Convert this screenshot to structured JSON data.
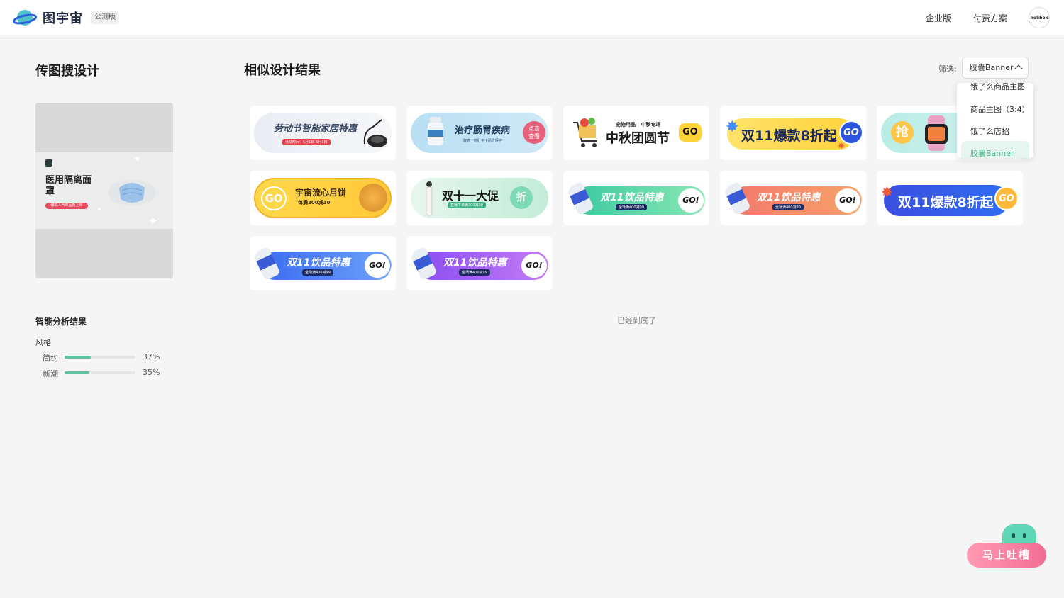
{
  "header": {
    "brand": "图宇宙",
    "beta_badge": "公测版",
    "nav": {
      "enterprise": "企业版",
      "pricing": "付费方案"
    },
    "avatar_text": "nolibox"
  },
  "left_panel": {
    "title": "传图搜设计",
    "upload_preview": {
      "title": "医用隔离面罩",
      "tag": "爆款人气单品新上市"
    },
    "analysis_title": "智能分析结果",
    "style_label": "风格",
    "styles": [
      {
        "name": "简约",
        "percent": 37,
        "label": "37%"
      },
      {
        "name": "新潮",
        "percent": 35,
        "label": "35%"
      }
    ]
  },
  "results": {
    "title": "相似设计结果",
    "filter_label": "筛选:",
    "filter_value": "胶囊Banner",
    "dropdown": [
      "饿了么商品主图",
      "商品主图（3:4）",
      "饿了么店招",
      "胶囊Banner"
    ],
    "cards": [
      {
        "text": "劳动节智能家居特惠",
        "sub": "活动时间：5月1日-5月3日",
        "theme": "labor"
      },
      {
        "text": "治疗肠胃疾病",
        "sub": "腹痛 | 拉肚子 | 肠胃保护",
        "badge": "点击查看",
        "theme": "stomach"
      },
      {
        "text": "中秋团圆节",
        "sub": "宠物用品 | 中秋专场",
        "badge": "GO",
        "theme": "midautumn"
      },
      {
        "text": "双11爆款8折起",
        "badge": "GO",
        "theme": "yellow11"
      },
      {
        "text": "抢",
        "theme": "watch"
      },
      {
        "text": "宇宙流心月饼",
        "sub": "每满200减30",
        "badge": "GO",
        "theme": "mooncake"
      },
      {
        "text": "双十一大促",
        "sub": "直播下单满300减30",
        "badge": "折",
        "theme": "promo11"
      },
      {
        "text": "双11饮品特惠",
        "sub": "全场满400减99",
        "badge": "GO!",
        "theme": "drink-green"
      },
      {
        "text": "双11饮品特惠",
        "sub": "全场满400减99",
        "badge": "GO!",
        "theme": "drink-orange"
      },
      {
        "text": "双11爆款8折起",
        "badge": "GO",
        "theme": "blue11"
      },
      {
        "text": "双11饮品特惠",
        "sub": "全场满400减99",
        "badge": "GO!",
        "theme": "drink-blue"
      },
      {
        "text": "双11饮品特惠",
        "sub": "全场满400减99",
        "badge": "GO!",
        "theme": "drink-purple"
      }
    ],
    "end_note": "已经到底了"
  },
  "feedback": {
    "label": "马上吐槽"
  }
}
